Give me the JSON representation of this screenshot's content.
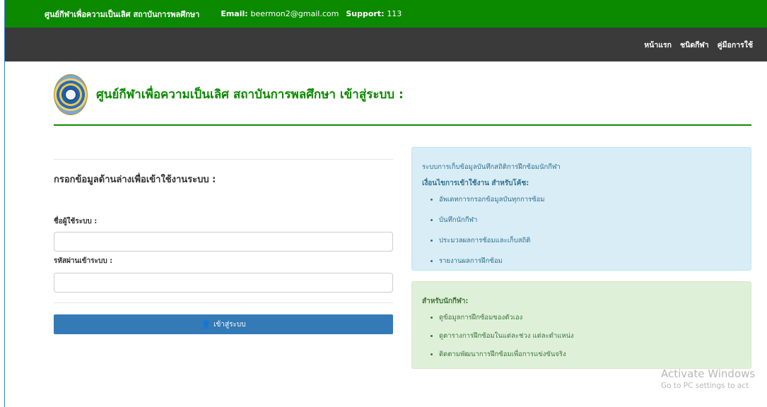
{
  "topbar": {
    "site_name": "ศูนย์กีฬาเพื่อความเป็นเลิศ สถาบันการพลศึกษา",
    "email_label": "Email:",
    "email_value": "beermon2@gmail.com",
    "support_label": "Support:",
    "support_value": "113",
    "bg_color": "#0b8a00"
  },
  "nav": {
    "items": [
      "หน้าแรก",
      "ชนิดกีฬา",
      "คู่มือการใช้"
    ]
  },
  "header": {
    "title": "ศูนย์กีฬาเพื่อความเป็นเลิศ สถาบันการพลศึกษา เข้าสู่ระบบ :",
    "logo_icon": "institute-seal-logo"
  },
  "form": {
    "title": "กรอกข้อมูลด้านล่างเพื่อเข้าใช้งานระบบ :",
    "username_label": "ชื่อผู้ใช้ระบบ :",
    "username_value": "",
    "password_label": "รหัสผ่านเข้าระบบ :",
    "password_value": "",
    "login_button": "เข้าสู่ระบบ",
    "login_icon": "user-icon",
    "button_color": "#337ab7"
  },
  "info_box": {
    "intro": "ระบบการเก็บข้อมูลบันทึกสถิติการฝึกซ้อมนักกีฬา",
    "heading": "เงื่อนไขการเข้าใช้งาน สำหรับโค้ช:",
    "items": [
      "อัพเดทการกรอกข้อมูลบันทุกการซ้อม",
      "บันทึกนักกีฬา",
      "ประมวลผลการซ้อมและเก็บสถิติ",
      "รายงานผลการฝึกซ้อม"
    ]
  },
  "athlete_box": {
    "heading": "สำหรับนักกีฬา:",
    "items": [
      "ดูข้อมูลการฝึกซ้อมของตัวเอง",
      "ดูตารางการฝึกซ้อมในแต่ละช่วง แต่ละตำแหน่ง",
      "ติดตามพัฒนาการฝึกซ้อมเพื่อการแข่งขันจริง"
    ]
  },
  "watermark": {
    "line1": "Activate Windows",
    "line2": "Go to PC settings to act"
  }
}
